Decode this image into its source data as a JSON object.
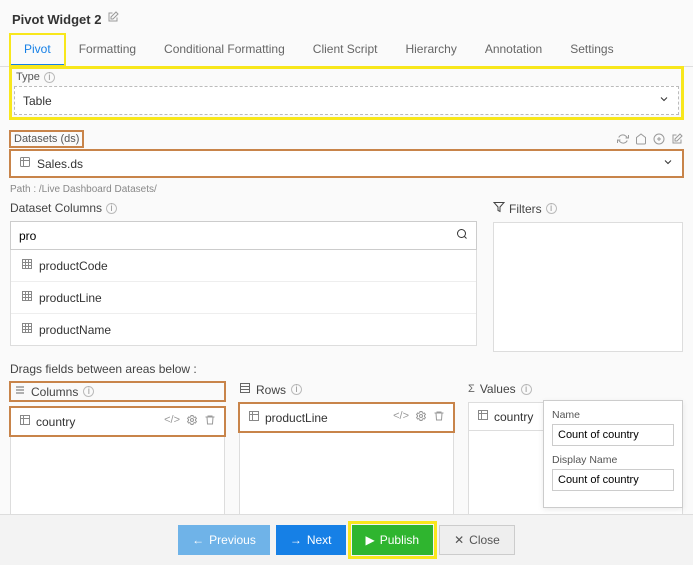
{
  "header": {
    "title": "Pivot Widget 2"
  },
  "tabs": [
    "Pivot",
    "Formatting",
    "Conditional Formatting",
    "Client Script",
    "Hierarchy",
    "Annotation",
    "Settings"
  ],
  "type": {
    "label": "Type",
    "value": "Table"
  },
  "datasets": {
    "label": "Datasets (ds)",
    "value": "Sales.ds",
    "path": "Path : /Live Dashboard Datasets/"
  },
  "datasetColumns": {
    "label": "Dataset Columns",
    "search": "pro",
    "items": [
      "productCode",
      "productLine",
      "productName"
    ]
  },
  "filters": {
    "label": "Filters"
  },
  "dragLabel": "Drags fields between areas below :",
  "zones": {
    "columns": {
      "label": "Columns",
      "chip": "country"
    },
    "rows": {
      "label": "Rows",
      "chip": "productLine"
    },
    "values": {
      "label": "Values",
      "chip": "country"
    }
  },
  "popover": {
    "nameLabel": "Name",
    "nameValue": "Count of country",
    "displayLabel": "Display Name",
    "displayValue": "Count of country"
  },
  "footer": {
    "previous": "Previous",
    "next": "Next",
    "publish": "Publish",
    "close": "Close"
  }
}
